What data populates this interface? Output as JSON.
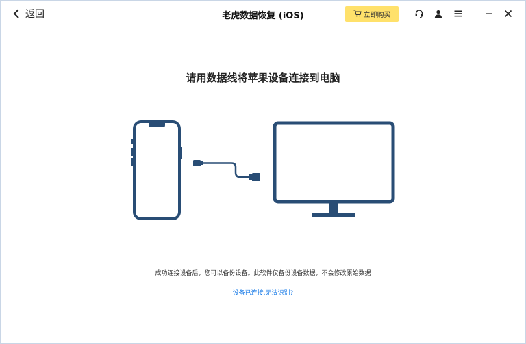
{
  "titlebar": {
    "back_label": "返回",
    "title": "老虎数据恢复 (iOS)",
    "buy_label": "立即购买",
    "buy_color": "#ffe16b"
  },
  "icons": {
    "back": "chevron-left-icon",
    "cart": "cart-icon",
    "support": "headset-icon",
    "account": "user-icon",
    "menu": "menu-icon",
    "minimize": "minimize-icon",
    "close": "close-icon"
  },
  "main": {
    "heading": "请用数据线将苹果设备连接到电脑",
    "info_text": "成功连接设备后，您可以备份设备。此软件仅备份设备数据，不会修改原始数据",
    "link_text": "设备已连接,无法识别?",
    "illustration_color": "#294d75",
    "link_color": "#1e7ee8"
  }
}
